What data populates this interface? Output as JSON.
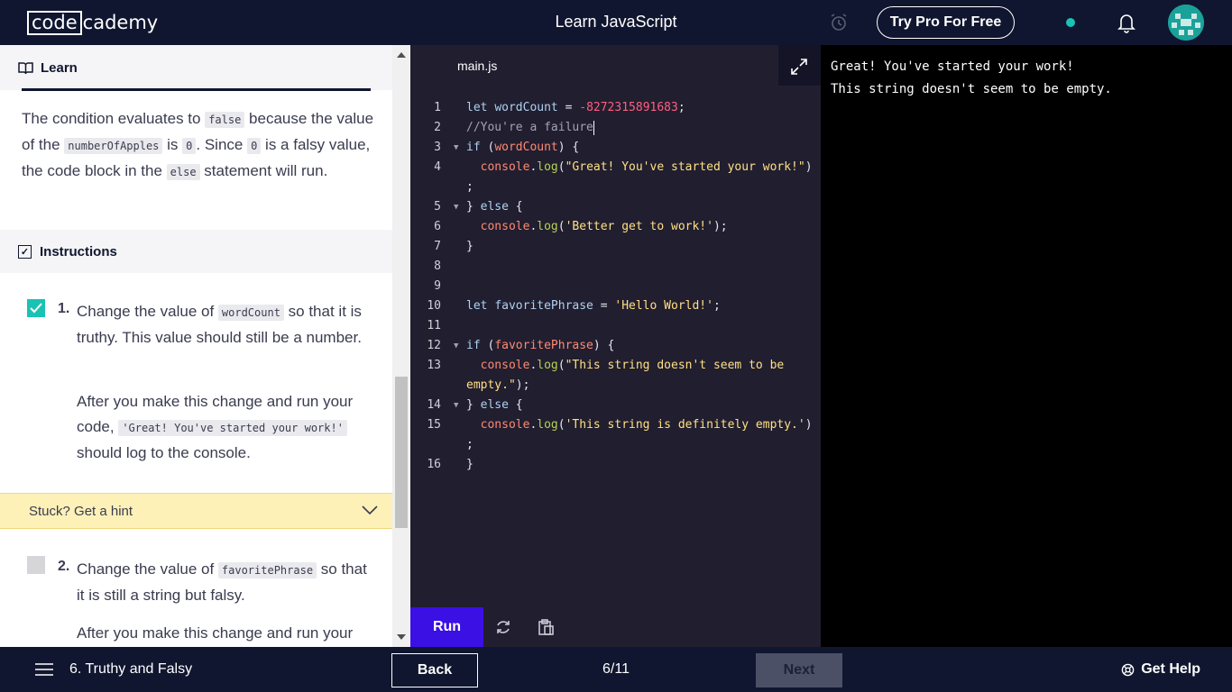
{
  "header": {
    "logo_box": "code",
    "logo_rest": "cademy",
    "course_title": "Learn JavaScript",
    "pro_button": "Try Pro For Free",
    "status_dot_color": "#19c3b4"
  },
  "learn": {
    "section_title": "Learn",
    "narrative": {
      "p1": "The condition evaluates to ",
      "c1": "false",
      "p2": " because the value of the ",
      "c2": "numberOfApples",
      "p3": " is ",
      "c3": "0",
      "p4": ". Since ",
      "c4": "0",
      "p5": " is a falsy value, the code block in the ",
      "c5": "else",
      "p6": " statement will run."
    }
  },
  "instructions": {
    "section_title": "Instructions",
    "tasks": [
      {
        "number": "1.",
        "checked": true,
        "p1": "Change the value of ",
        "c1": "wordCount",
        "p2": " so that it is truthy. This value should still be a number.",
        "p3": "After you make this change and run your code, ",
        "c2": "'Great! You've started your work!'",
        "p4": " should log to the console."
      },
      {
        "number": "2.",
        "checked": false,
        "p1": "Change the value of ",
        "c1": "favoritePhrase",
        "p2": " so that it is still a string but falsy.",
        "p3": "After you make this change and run your"
      }
    ],
    "hint": "Stuck? Get a hint"
  },
  "editor": {
    "filename": "main.js",
    "line_numbers": [
      "1",
      "2",
      "3",
      "4",
      "",
      "5",
      "6",
      "7",
      "8",
      "9",
      "10",
      "11",
      "12",
      "13",
      "",
      "14",
      "15",
      "",
      "16"
    ],
    "run_label": "Run"
  },
  "output": {
    "lines": [
      "Great! You've started your work!",
      "This string doesn't seem to be empty."
    ]
  },
  "footer": {
    "lesson_title": "6. Truthy and Falsy",
    "back_label": "Back",
    "progress": "6/11",
    "next_label": "Next",
    "help_label": "Get Help"
  },
  "colors": {
    "brand_navy": "#10162f",
    "run_purple": "#3a10e5",
    "hint_yellow": "#fdf1b8",
    "check_teal": "#19c3b4"
  }
}
